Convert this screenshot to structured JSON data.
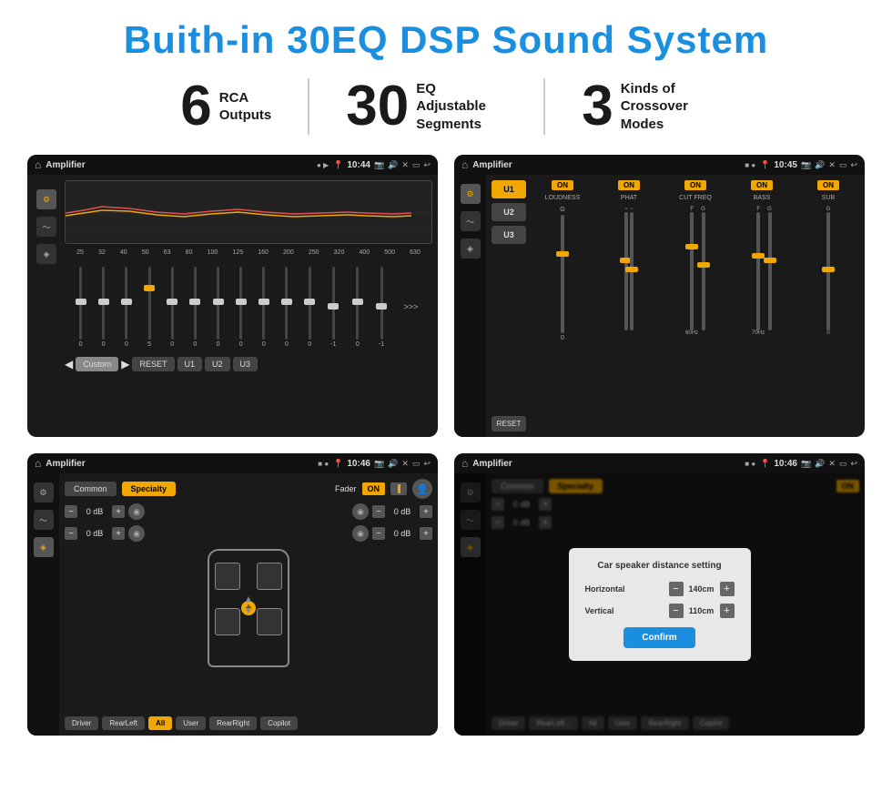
{
  "header": {
    "title": "Buith-in 30EQ DSP Sound System"
  },
  "stats": [
    {
      "number": "6",
      "text": "RCA\nOutputs"
    },
    {
      "number": "30",
      "text": "EQ Adjustable\nSegments"
    },
    {
      "number": "3",
      "text": "Kinds of\nCrossover Modes"
    }
  ],
  "screen1": {
    "status": {
      "title": "Amplifier",
      "time": "10:44"
    },
    "eq_presets": [
      "Custom",
      "RESET",
      "U1",
      "U2",
      "U3"
    ],
    "freq_labels": [
      "25",
      "32",
      "40",
      "50",
      "63",
      "80",
      "100",
      "125",
      "160",
      "200",
      "250",
      "320",
      "400",
      "500",
      "630"
    ],
    "slider_values": [
      "0",
      "0",
      "0",
      "5",
      "0",
      "0",
      "0",
      "0",
      "0",
      "0",
      "0",
      "-1",
      "0",
      "-1"
    ]
  },
  "screen2": {
    "status": {
      "title": "Amplifier",
      "time": "10:45"
    },
    "presets": [
      "U1",
      "U2",
      "U3"
    ],
    "channels": [
      {
        "label": "LOUDNESS",
        "on": true
      },
      {
        "label": "PHAT",
        "on": true
      },
      {
        "label": "CUT FREQ",
        "on": true
      },
      {
        "label": "BASS",
        "on": true
      },
      {
        "label": "SUB",
        "on": true
      }
    ],
    "reset_label": "RESET"
  },
  "screen3": {
    "status": {
      "title": "Amplifier",
      "time": "10:46"
    },
    "tabs": [
      "Common",
      "Specialty"
    ],
    "fader_label": "Fader",
    "on_label": "ON",
    "db_values": [
      "0 dB",
      "0 dB",
      "0 dB",
      "0 dB"
    ],
    "buttons": [
      "Driver",
      "RearLeft",
      "All",
      "User",
      "RearRight",
      "Copilot"
    ]
  },
  "screen4": {
    "status": {
      "title": "Amplifier",
      "time": "10:46"
    },
    "tabs": [
      "Common",
      "Specialty"
    ],
    "on_label": "ON",
    "dialog": {
      "title": "Car speaker distance setting",
      "horizontal_label": "Horizontal",
      "horizontal_value": "140cm",
      "vertical_label": "Vertical",
      "vertical_value": "110cm",
      "confirm_label": "Confirm",
      "db_values": [
        "0 dB",
        "0 dB"
      ]
    },
    "buttons": [
      "Driver",
      "RearLeft",
      "All",
      "User",
      "RearRight",
      "Copilot"
    ]
  }
}
